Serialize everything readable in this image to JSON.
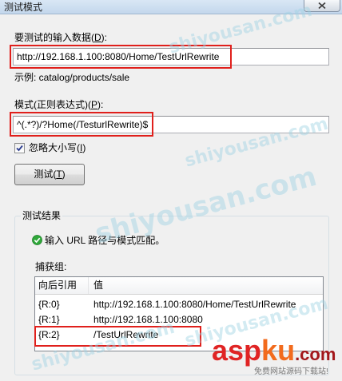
{
  "window": {
    "title": "测试模式"
  },
  "input_section": {
    "label_parts": [
      "要测试的输入数据(",
      "D",
      "):"
    ],
    "value": "http://192.168.1.100:8080/Home/TestUrlRewrite",
    "example": "示例: catalog/products/sale"
  },
  "pattern_section": {
    "label_parts": [
      "模式(正则表达式)(",
      "P",
      "):"
    ],
    "value": "^(.*?)/?Home(/TesturlRewrite)$"
  },
  "ignore_case": {
    "label_parts": [
      "忽略大小写(",
      "I",
      ")"
    ],
    "checked": true
  },
  "test_button": {
    "label_parts": [
      "测试(",
      "T",
      ")"
    ]
  },
  "results": {
    "group_title": "测试结果",
    "status": "输入 URL 路径与模式匹配。",
    "captures_label": "捕获组:",
    "columns": [
      "向后引用",
      "值"
    ],
    "rows": [
      {
        "ref": "{R:0}",
        "value": "http://192.168.1.100:8080/Home/TestUrlRewrite"
      },
      {
        "ref": "{R:1}",
        "value": "http://192.168.1.100:8080"
      },
      {
        "ref": "{R:2}",
        "value": "/TestUrlRewrite"
      }
    ]
  },
  "icons": {
    "close": "close-icon",
    "checkbox": "check-icon",
    "status": "success-check-icon"
  },
  "colors": {
    "highlight": "#e0201c",
    "success": "#2fa83a",
    "watermark": "#9fd3e4"
  },
  "watermark": {
    "text": "shiyousan.com"
  },
  "logo": {
    "parts": [
      "asp",
      "ku",
      ".com"
    ],
    "tagline": "免费网站源码下载站!",
    "colors": {
      "asp": "#e02424",
      "ku": "#f26b1d",
      "com": "#a3161a"
    }
  }
}
